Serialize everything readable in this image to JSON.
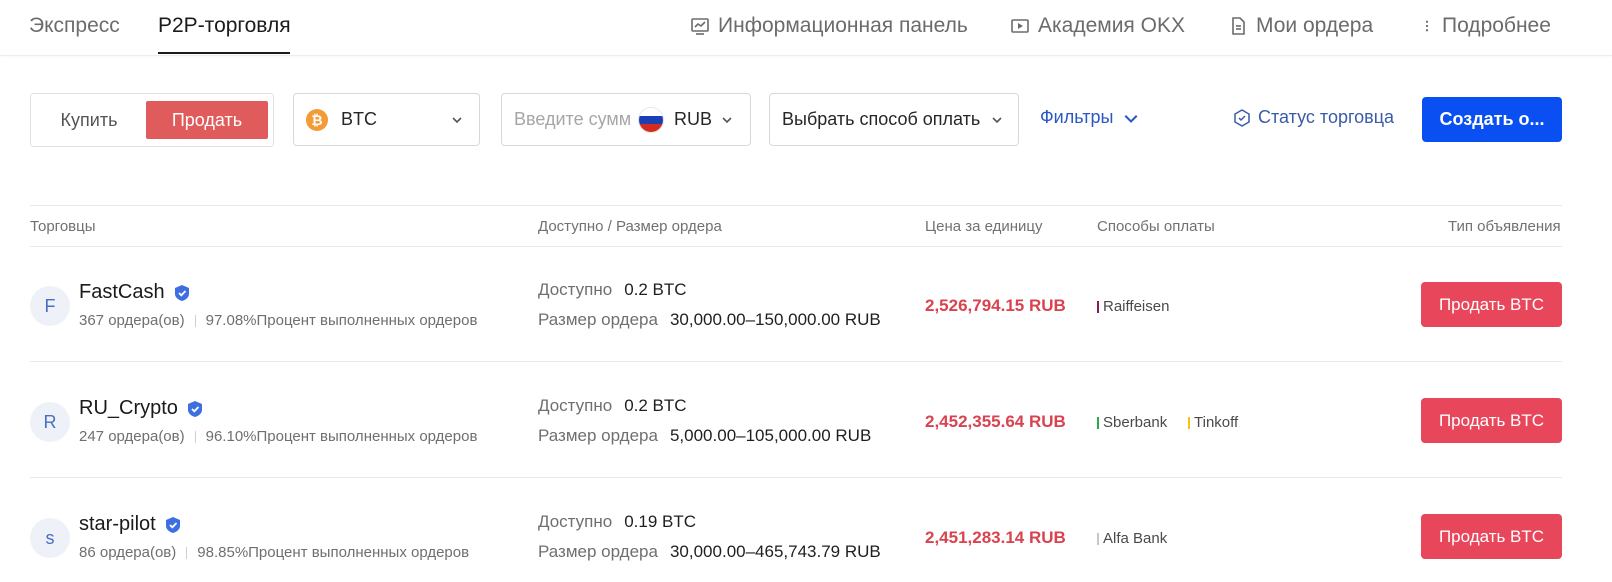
{
  "nav": {
    "tabs": [
      {
        "label": "Экспресс"
      },
      {
        "label": "P2P-торговля"
      }
    ],
    "links": [
      {
        "label": "Информационная панель",
        "icon": "dashboard-chart-icon"
      },
      {
        "label": "Академия OKX",
        "icon": "video-play-icon"
      },
      {
        "label": "Мои ордера",
        "icon": "document-icon"
      },
      {
        "label": "Подробнее",
        "icon": "more-vertical-icon"
      }
    ]
  },
  "controls": {
    "buy_label": "Купить",
    "sell_label": "Продать",
    "coin": "BTC",
    "amount_placeholder": "Введите сумм",
    "currency": "RUB",
    "payment_placeholder": "Выбрать способ оплать",
    "filters_label": "Фильтры",
    "trader_status_label": "Статус торговца",
    "create_label": "Создать о..."
  },
  "table": {
    "headers": {
      "traders": "Торговцы",
      "available": "Доступно / Размер ордера",
      "price": "Цена за единицу",
      "payment": "Способы оплаты",
      "ad_type": "Тип объявления"
    },
    "available_label": "Доступно",
    "order_size_label": "Размер ордера",
    "rows": [
      {
        "initial": "F",
        "name": "FastCash",
        "orders": "367 ордера(ов)",
        "completion": "97.08%Процент выполненных ордеров",
        "available": "0.2 BTC",
        "order_size": "30,000.00–150,000.00 RUB",
        "price": "2,526,794.15 RUB",
        "payments": [
          {
            "name": "Raiffeisen",
            "color": "#8a1a5a"
          }
        ],
        "action": "Продать BTC"
      },
      {
        "initial": "R",
        "name": "RU_Crypto",
        "orders": "247 ордера(ов)",
        "completion": "96.10%Процент выполненных ордеров",
        "available": "0.2 BTC",
        "order_size": "5,000.00–105,000.00 RUB",
        "price": "2,452,355.64 RUB",
        "payments": [
          {
            "name": "Sberbank",
            "color": "#2aa84a"
          },
          {
            "name": "Tinkoff",
            "color": "#f3c21b"
          }
        ],
        "action": "Продать BTC"
      },
      {
        "initial": "s",
        "name": "star-pilot",
        "orders": "86 ордера(ов)",
        "completion": "98.85%Процент выполненных ордеров",
        "available": "0.19 BTC",
        "order_size": "30,000.00–465,743.79 RUB",
        "price": "2,451,283.14 RUB",
        "payments": [
          {
            "name": "Alfa Bank",
            "color": "#c8c8c8"
          }
        ],
        "action": "Продать BTC"
      }
    ]
  }
}
